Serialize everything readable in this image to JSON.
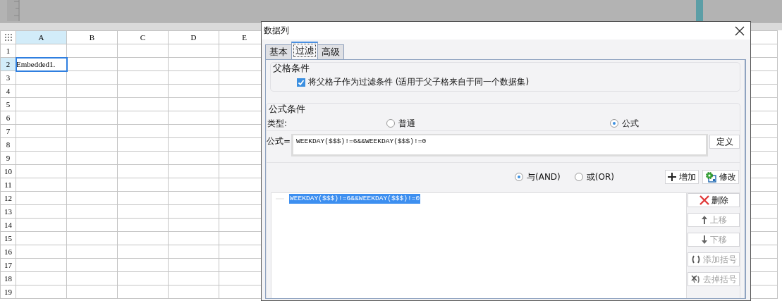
{
  "sheet": {
    "columns": [
      {
        "label": "A",
        "selected": true
      },
      {
        "label": "B",
        "selected": false
      },
      {
        "label": "C",
        "selected": false
      },
      {
        "label": "D",
        "selected": false
      },
      {
        "label": "E",
        "selected": false
      }
    ],
    "rows": [
      {
        "label": "1",
        "selected": false
      },
      {
        "label": "2",
        "selected": true,
        "cells": [
          {
            "text": "Embedded1.",
            "selected": true
          }
        ]
      },
      {
        "label": "3",
        "selected": false
      },
      {
        "label": "4",
        "selected": false
      },
      {
        "label": "5",
        "selected": false
      },
      {
        "label": "6",
        "selected": false
      },
      {
        "label": "7",
        "selected": false
      },
      {
        "label": "8",
        "selected": false
      },
      {
        "label": "9",
        "selected": false
      },
      {
        "label": "10",
        "selected": false
      },
      {
        "label": "11",
        "selected": false
      },
      {
        "label": "12",
        "selected": false
      },
      {
        "label": "13",
        "selected": false
      },
      {
        "label": "14",
        "selected": false
      },
      {
        "label": "15",
        "selected": false
      },
      {
        "label": "16",
        "selected": false
      },
      {
        "label": "17",
        "selected": false
      },
      {
        "label": "18",
        "selected": false
      },
      {
        "label": "19",
        "selected": false
      }
    ]
  },
  "dialog": {
    "title": "数据列",
    "tabs": [
      {
        "label": "基本",
        "selected": false
      },
      {
        "label": "过滤",
        "selected": true
      },
      {
        "label": "高级",
        "selected": false
      }
    ],
    "parent_group": {
      "title": "父格条件",
      "checkbox": {
        "label": "将父格子作为过滤条件 (适用于父子格来自于同一个数据集)",
        "checked": true
      }
    },
    "formula_group": {
      "title": "公式条件",
      "type_label": "类型:",
      "type_options": [
        {
          "label": "普通",
          "selected": false
        },
        {
          "label": "公式",
          "selected": true
        }
      ],
      "formula_label": "公式=",
      "formula_value": "WEEKDAY($$$)!=6&&WEEKDAY($$$)!=0",
      "define_button": "定义",
      "join_options": [
        {
          "label": "与(AND)",
          "selected": true
        },
        {
          "label": "或(OR)",
          "selected": false
        }
      ],
      "toolbar_buttons": [
        {
          "label": "增加",
          "kind": "add"
        },
        {
          "label": "修改",
          "kind": "edit"
        }
      ],
      "conditions": [
        {
          "text": "WEEKDAY($$$)!=6&&WEEKDAY($$$)!=0",
          "selected": true
        }
      ],
      "side_buttons": [
        {
          "label": "删除",
          "kind": "delete",
          "disabled": false
        },
        {
          "label": "上移",
          "kind": "up",
          "disabled": true
        },
        {
          "label": "下移",
          "kind": "down",
          "disabled": true
        },
        {
          "label": "添加括号",
          "kind": "add_paren",
          "disabled": true
        },
        {
          "label": "去掉括号",
          "kind": "remove_paren",
          "disabled": true
        }
      ]
    }
  }
}
